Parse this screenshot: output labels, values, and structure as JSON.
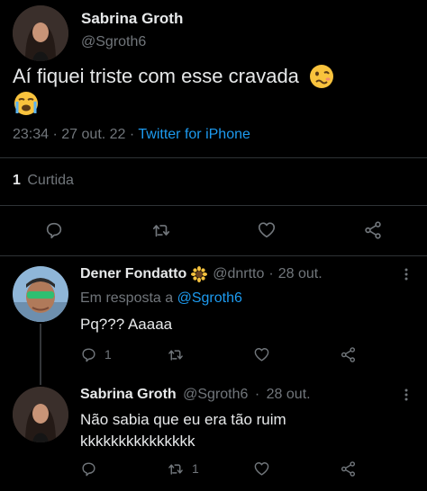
{
  "main_tweet": {
    "author_name": "Sabrina Groth",
    "author_handle": "@Sgroth6",
    "text": "Aí fiquei triste com esse cravada",
    "time": "23:34",
    "date": "27 out. 22",
    "separator": "·",
    "source": "Twitter for iPhone",
    "likes_count": "1",
    "likes_label": "Curtida",
    "emojis": [
      "woozy-face",
      "loudly-crying-face"
    ]
  },
  "reply_1": {
    "author_name": "Dener Fondatto",
    "author_emoji": "sunflower",
    "author_handle": "@dnrtto",
    "date": "28 out.",
    "separator": "·",
    "replying_label": "Em resposta a",
    "replying_to": "@Sgroth6",
    "text": "Pq??? Aaaaa",
    "reply_count": "1",
    "retweet_count": "",
    "like_count": ""
  },
  "reply_2": {
    "author_name": "Sabrina Groth",
    "author_handle": "@Sgroth6",
    "date": "28 out.",
    "separator": "·",
    "text_line1": "Não sabia que eu era tão ruim",
    "text_line2": "kkkkkkkkkkkkkkk",
    "reply_count": "",
    "retweet_count": "1",
    "like_count": ""
  },
  "colors": {
    "background": "#000000",
    "text": "#e7e9ea",
    "muted": "#71767b",
    "link": "#1d9bf0",
    "divider": "#2f3336"
  }
}
